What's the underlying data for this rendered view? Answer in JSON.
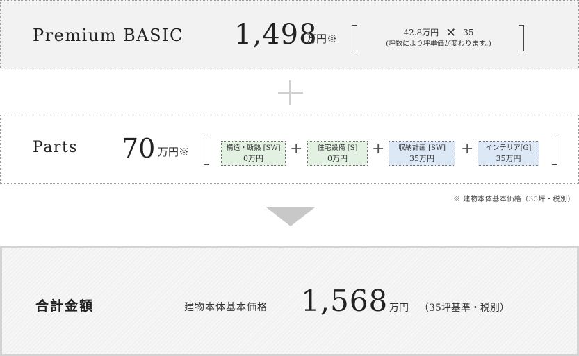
{
  "basic": {
    "title": "Premium BASIC",
    "price": "1,498",
    "unit": "万円※",
    "calc_unit_price": "42.8万円",
    "calc_times": "✕",
    "calc_tsubo": "35",
    "calc_note": "(坪数により坪単価が変わります。)"
  },
  "parts": {
    "title": "Parts",
    "price": "70",
    "unit": "万円※",
    "items": [
      {
        "label": "構造・断熱 [SW]",
        "value": "0万円",
        "color": "#e3f1e3"
      },
      {
        "label": "住宅設備 [S]",
        "value": "0万円",
        "color": "#e3f1e3"
      },
      {
        "label": "収納計画 [SW]",
        "value": "35万円",
        "color": "#dde8f7"
      },
      {
        "label": "インテリア[G]",
        "value": "35万円",
        "color": "#dde8f7"
      }
    ],
    "plus_sign": "+"
  },
  "note": "※ 建物本体基本価格（35坪・税別）",
  "total": {
    "title": "合計金額",
    "label": "建物本体基本価格",
    "price": "1,568",
    "unit": "万円",
    "unit_note": "（35坪基準・税別）"
  }
}
